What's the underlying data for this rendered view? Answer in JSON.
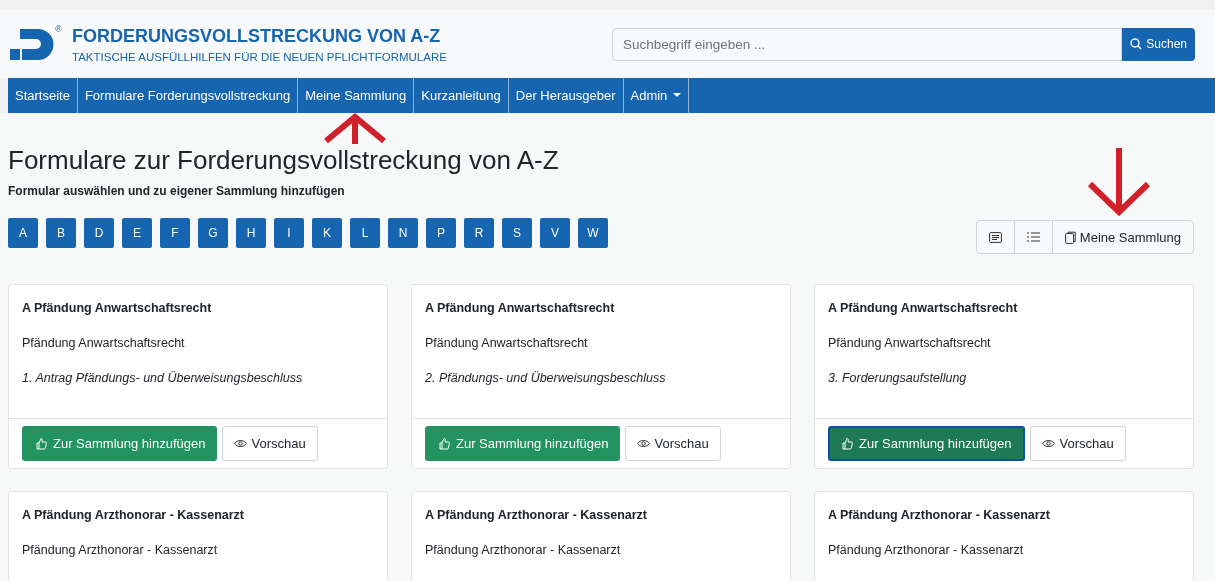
{
  "header": {
    "logo_mark": "®",
    "title": "FORDERUNGSVOLLSTRECKUNG VON A-Z",
    "subtitle": "TAKTISCHE AUSFÜLLHILFEN FÜR DIE NEUEN PFLICHTFORMULARE"
  },
  "search": {
    "placeholder": "Suchbegriff eingeben ...",
    "button": "Suchen"
  },
  "nav": [
    {
      "label": "Startseite",
      "dropdown": false
    },
    {
      "label": "Formulare Forderungsvollstreckung",
      "dropdown": false
    },
    {
      "label": "Meine Sammlung",
      "dropdown": false
    },
    {
      "label": "Kurzanleitung",
      "dropdown": false
    },
    {
      "label": "Der Herausgeber",
      "dropdown": false
    },
    {
      "label": "Admin",
      "dropdown": true
    }
  ],
  "heading": "Formulare zur Forderungsvollstreckung von A-Z",
  "subheading": "Formular auswählen und zu eigener Sammlung hinzufügen",
  "letters": [
    "A",
    "B",
    "D",
    "E",
    "F",
    "G",
    "H",
    "I",
    "K",
    "L",
    "N",
    "P",
    "R",
    "S",
    "V",
    "W"
  ],
  "view_toolbar": {
    "collection_button": "Meine Sammlung"
  },
  "cards": [
    {
      "title": "A Pfändung Anwartschaftsrecht",
      "name": "Pfändung Anwartschaftsrecht",
      "form": "1. Antrag Pfändungs- und Überweisungsbeschluss",
      "add_label": "Zur Sammlung hinzufügen",
      "preview_label": "Vorschau",
      "focused": false
    },
    {
      "title": "A Pfändung Anwartschaftsrecht",
      "name": "Pfändung Anwartschaftsrecht",
      "form": "2. Pfändungs- und Überweisungsbeschluss",
      "add_label": "Zur Sammlung hinzufügen",
      "preview_label": "Vorschau",
      "focused": false
    },
    {
      "title": "A Pfändung Anwartschaftsrecht",
      "name": "Pfändung Anwartschaftsrecht",
      "form": "3. Forderungsaufstellung",
      "add_label": "Zur Sammlung hinzufügen",
      "preview_label": "Vorschau",
      "focused": true
    },
    {
      "title": "A Pfändung Arzthonorar - Kassenarzt",
      "name": "Pfändung Arzthonorar - Kassenarzt"
    },
    {
      "title": "A Pfändung Arzthonorar - Kassenarzt",
      "name": "Pfändung Arzthonorar - Kassenarzt"
    },
    {
      "title": "A Pfändung Arzthonorar - Kassenarzt",
      "name": "Pfändung Arzthonorar - Kassenarzt"
    }
  ]
}
